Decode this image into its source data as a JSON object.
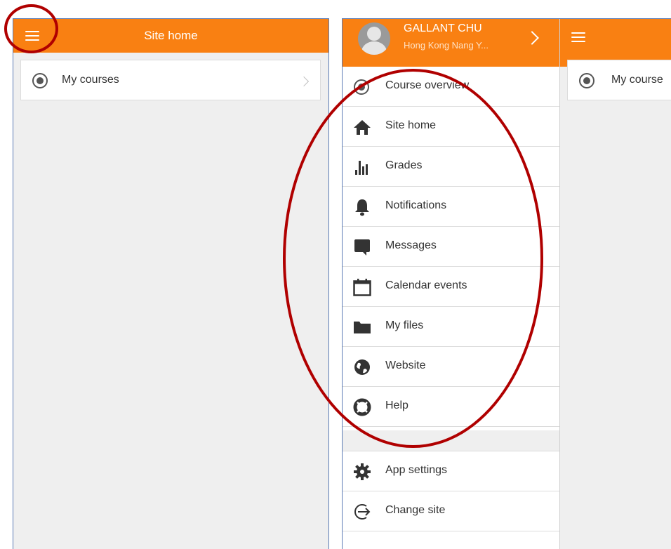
{
  "left_screen": {
    "title": "Site home",
    "rows": [
      {
        "label": "My courses"
      }
    ]
  },
  "side_menu": {
    "user": {
      "name": "GALLANT CHU",
      "site": "Hong Kong Nang Y..."
    },
    "items": [
      {
        "label": "Course overview",
        "icon": "radio-icon"
      },
      {
        "label": "Site home",
        "icon": "home-icon"
      },
      {
        "label": "Grades",
        "icon": "grades-icon"
      },
      {
        "label": "Notifications",
        "icon": "bell-icon"
      },
      {
        "label": "Messages",
        "icon": "message-icon"
      },
      {
        "label": "Calendar events",
        "icon": "calendar-icon"
      },
      {
        "label": "My files",
        "icon": "folder-icon"
      },
      {
        "label": "Website",
        "icon": "globe-icon"
      },
      {
        "label": "Help",
        "icon": "lifebuoy-icon"
      }
    ],
    "footer_items": [
      {
        "label": "App settings",
        "icon": "gear-icon"
      },
      {
        "label": "Change site",
        "icon": "exit-icon"
      }
    ]
  },
  "right_screen_peek": {
    "row_label": "My course"
  },
  "colors": {
    "accent": "#f98012",
    "annotation": "#b00000",
    "background": "#efefef"
  }
}
